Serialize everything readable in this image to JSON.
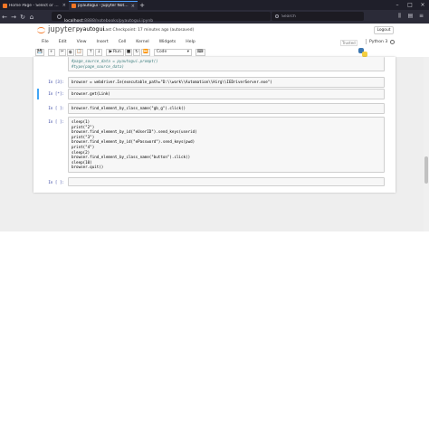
{
  "browser": {
    "tabs": [
      {
        "label": "Home Page - Select or create a notebook",
        "active": false
      },
      {
        "label": "pyautogui - Jupyter Notebook",
        "active": true
      }
    ],
    "new_tab": "+",
    "url_host": "localhost",
    "url_path": ":8888/notebooks/pyautogui.ipynb",
    "search_placeholder": "Search"
  },
  "jupyter": {
    "logo_text": "jupyter",
    "notebook_name": "pyautogui",
    "checkpoint": "Last Checkpoint: 17 minutes ago  (autosaved)",
    "logout": "Logout",
    "trusted": "Trusted",
    "kernel": "Python 3",
    "menu": [
      "File",
      "Edit",
      "View",
      "Insert",
      "Cell",
      "Kernel",
      "Widgets",
      "Help"
    ],
    "toolbar": {
      "save": "💾",
      "add": "+",
      "cut": "✂",
      "copy": "⧉",
      "paste": "📋",
      "up": "↑",
      "down": "↓",
      "run": "Run",
      "stop": "■",
      "restart": "↻",
      "fast": "⏩",
      "cell_type": "Code",
      "keyboard": "⌨"
    }
  },
  "cells": [
    {
      "prompt": "",
      "lines": [
        "#page_source_data = pyautogui.prompt()",
        "#type(page_source_data)"
      ]
    },
    {
      "prompt": "In [3]:",
      "lines": [
        "browser = webdriver.Ie(executable_path=\"D:\\\\work\\\\Automation\\\\Hirg\\\\IEDriverServer.exe\")"
      ]
    },
    {
      "prompt": "In [*]:",
      "lines": [
        "browser.get(Link)"
      ]
    },
    {
      "prompt": "In [ ]:",
      "lines": [
        "browser.find_element_by_class_name(\"gb_g\").click()"
      ]
    },
    {
      "prompt": "In [ ]:",
      "lines": [
        "sleep(1)",
        "print(\"2\")",
        "browser.find_element_by_id(\"eUserID\").send_keys(userid)",
        "print(\"3\")",
        "browser.find_element_by_id(\"ePassword\").send_keys(pwd)",
        "print(\"4\")",
        "sleep(2)",
        "browser.find_element_by_class_name(\"button\").click()",
        "sleep(10)",
        "browser.quit()"
      ]
    },
    {
      "prompt": "In [ ]:",
      "lines": [
        ""
      ]
    }
  ],
  "colors": {
    "accent": "#f37726",
    "selected_cell": "#42a5f5",
    "prompt": "#303f9f"
  }
}
